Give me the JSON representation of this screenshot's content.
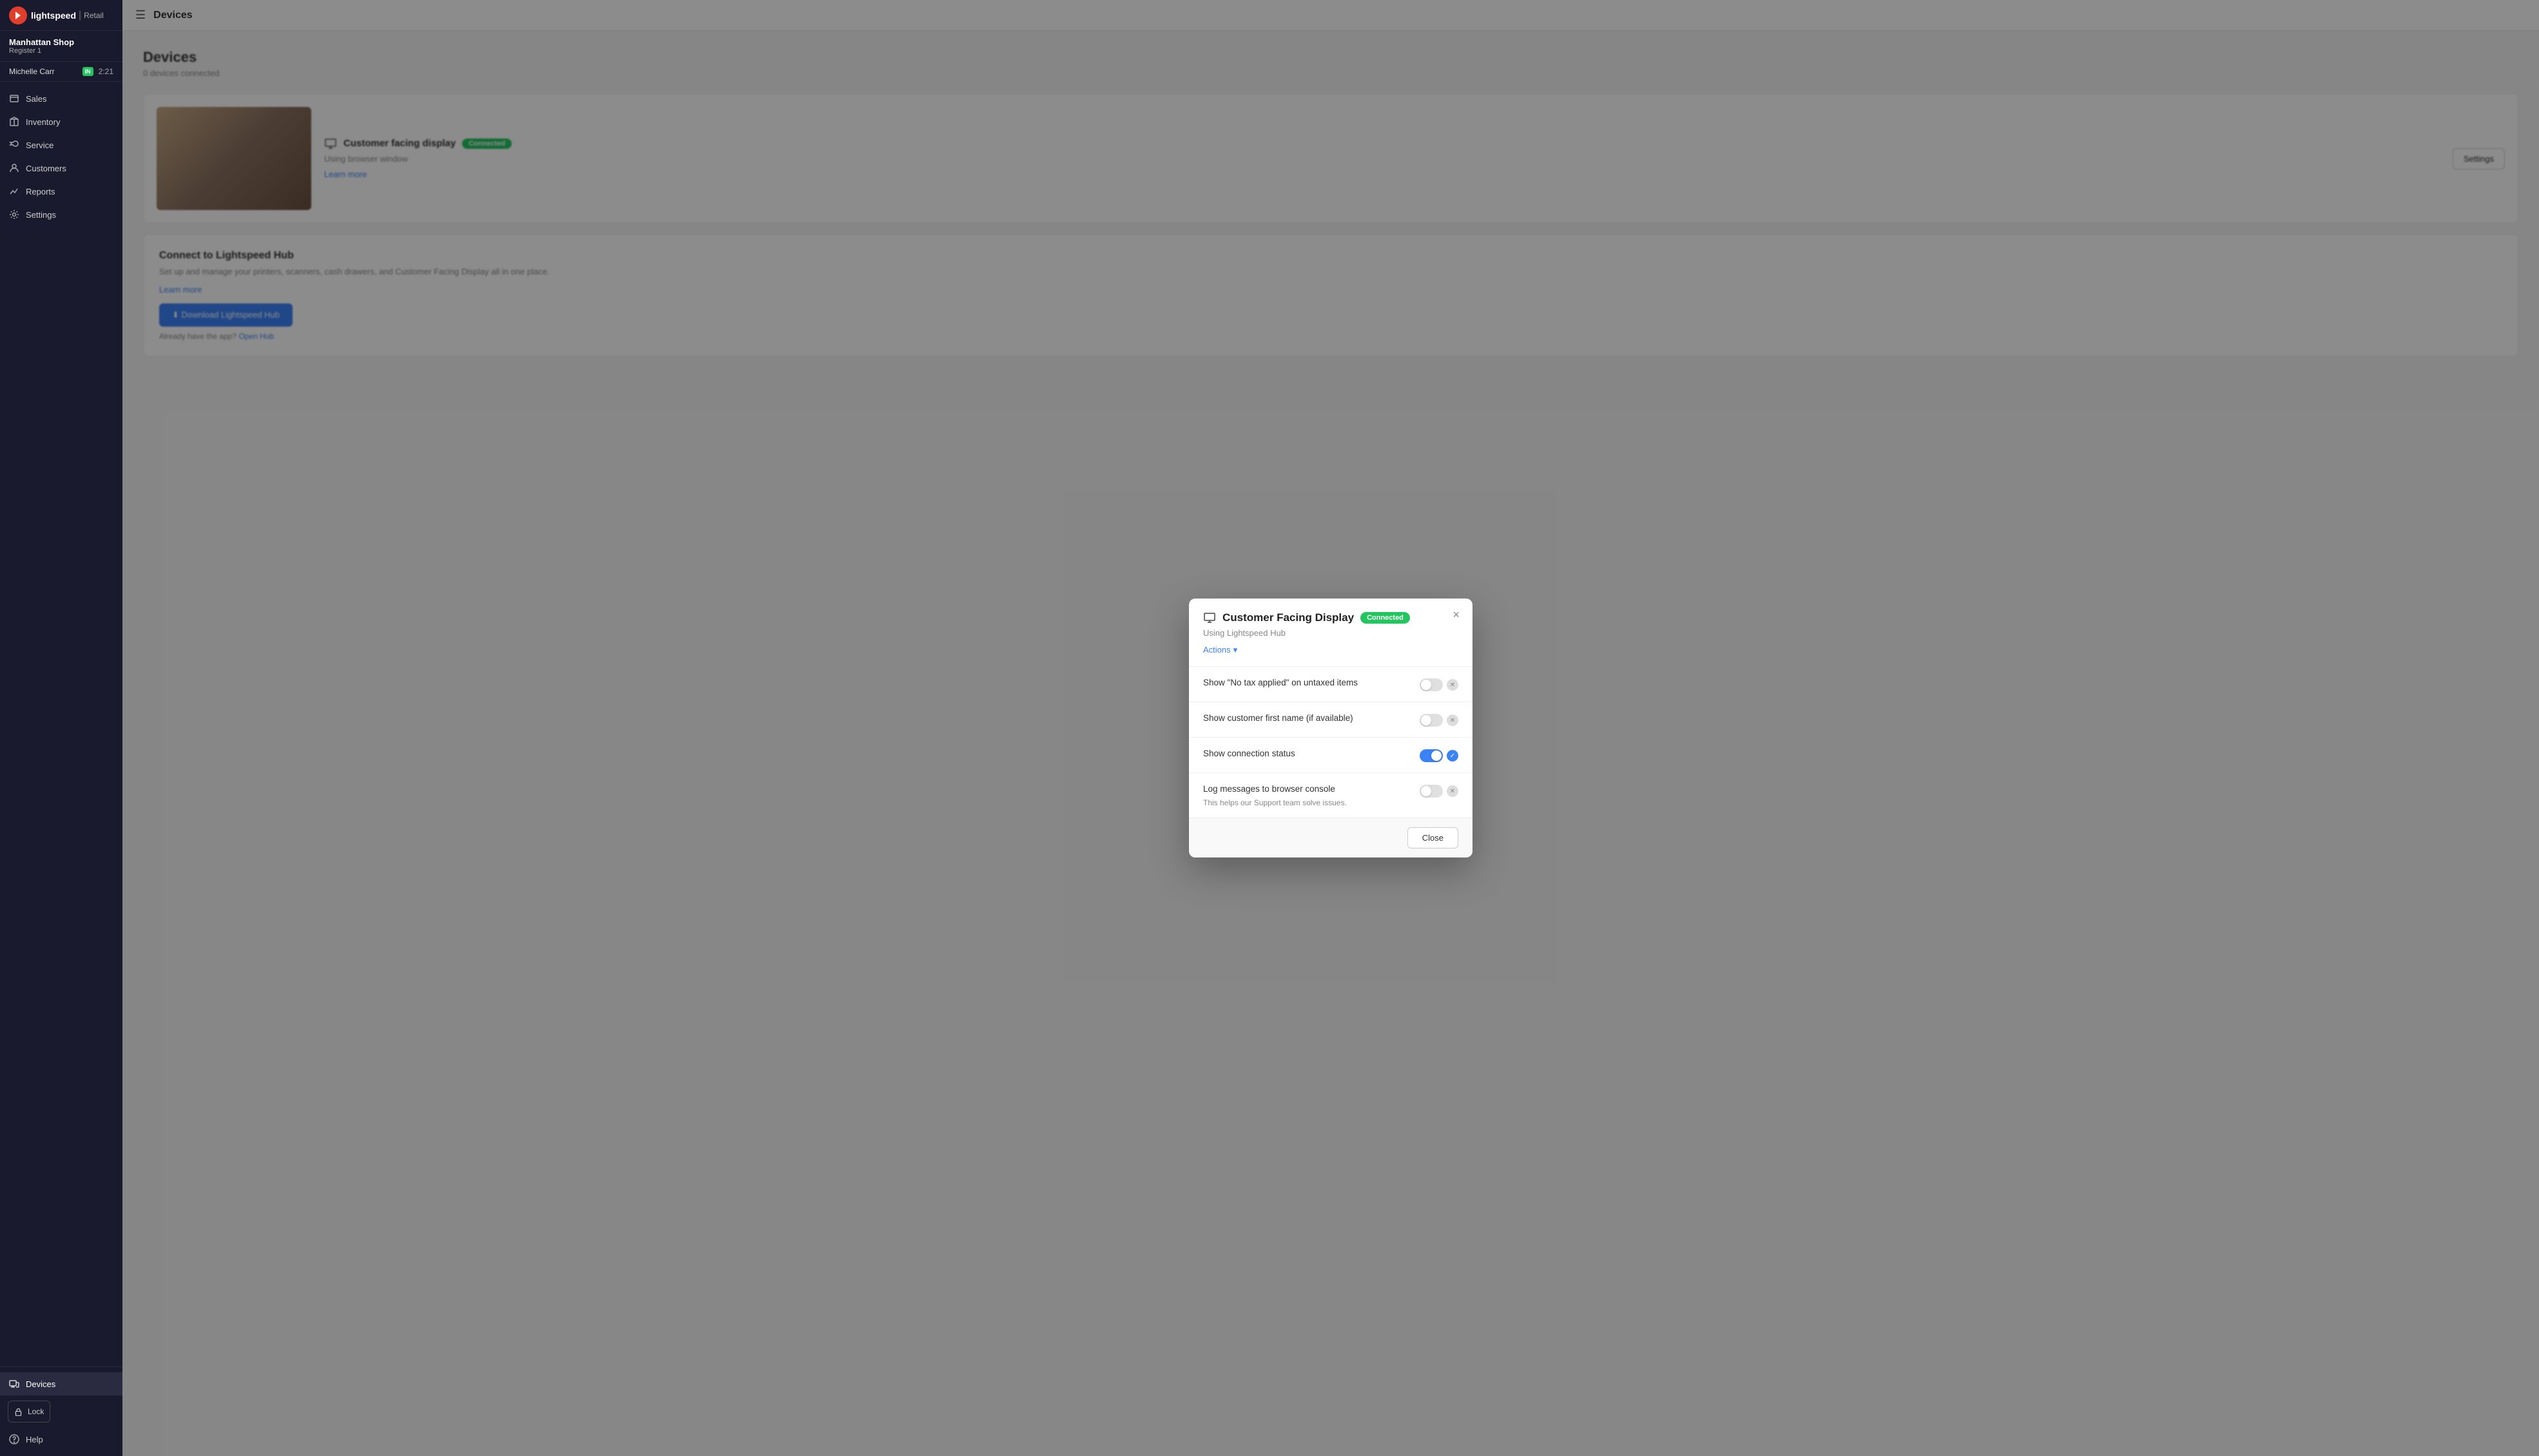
{
  "app": {
    "logo_brand": "lightspeed",
    "logo_divider": "|",
    "logo_product": "Retail"
  },
  "sidebar": {
    "store_name": "Manhattan Shop",
    "register": "Register 1",
    "user_name": "Michelle Carr",
    "user_status": "IN",
    "timer": "2:21",
    "nav_items": [
      {
        "id": "sales",
        "label": "Sales",
        "icon": "dollar-icon"
      },
      {
        "id": "inventory",
        "label": "Inventory",
        "icon": "box-icon"
      },
      {
        "id": "service",
        "label": "Service",
        "icon": "wrench-icon"
      },
      {
        "id": "customers",
        "label": "Customers",
        "icon": "person-icon"
      },
      {
        "id": "reports",
        "label": "Reports",
        "icon": "chart-icon"
      },
      {
        "id": "settings",
        "label": "Settings",
        "icon": "gear-icon"
      }
    ],
    "devices_label": "Devices",
    "lock_label": "Lock",
    "help_label": "Help"
  },
  "topbar": {
    "page_title": "Devices"
  },
  "content": {
    "heading": "Devices",
    "subtext": "0 devices connected",
    "device_card": {
      "name": "Customer facing display",
      "status": "Connected",
      "description": "Using browser window",
      "learn_more": "Learn more",
      "settings_label": "Settings"
    },
    "connect_section": {
      "title": "Connect to Lightspeed Hub",
      "description": "Set up and manage your printers, scanners, cash drawers, and Customer Facing Display all in one place.",
      "learn_more": "Learn more",
      "download_label": "Download Lightspeed Hub",
      "already_have": "Already have the app?",
      "open_hub": "Open Hub"
    }
  },
  "modal": {
    "icon": "monitor-icon",
    "title": "Customer Facing Display",
    "connected_badge": "Connected",
    "subtitle": "Using Lightspeed Hub",
    "actions_label": "Actions",
    "close_icon": "×",
    "toggles": [
      {
        "id": "no-tax",
        "label": "Show \"No tax applied\" on untaxed items",
        "sublabel": "",
        "state": "off"
      },
      {
        "id": "customer-name",
        "label": "Show customer first name (if available)",
        "sublabel": "",
        "state": "off"
      },
      {
        "id": "connection-status",
        "label": "Show connection status",
        "sublabel": "",
        "state": "on"
      },
      {
        "id": "log-messages",
        "label": "Log messages to browser console",
        "sublabel": "This helps our Support team solve issues.",
        "state": "off"
      }
    ],
    "close_btn_label": "Close"
  }
}
